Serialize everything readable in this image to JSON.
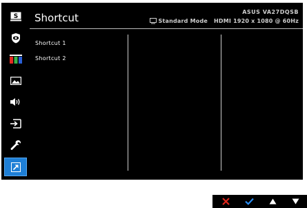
{
  "header": {
    "title": "Shortcut",
    "model": "ASUS VA27DQSB",
    "mode": "Standard Mode",
    "input_info": "HDMI 1920 x 1080 @ 60Hz"
  },
  "sidebar": {
    "items": [
      {
        "icon": "splendid-s-icon"
      },
      {
        "icon": "eye-care-icon"
      },
      {
        "icon": "color-icon"
      },
      {
        "icon": "image-icon"
      },
      {
        "icon": "sound-icon"
      },
      {
        "icon": "input-select-icon"
      },
      {
        "icon": "system-setup-icon"
      },
      {
        "icon": "shortcut-icon",
        "active": true
      }
    ]
  },
  "menu": {
    "items": [
      "Shortcut 1",
      "Shortcut 2"
    ]
  },
  "nav": {
    "buttons": [
      "close-icon",
      "check-icon",
      "up-arrow-icon",
      "down-arrow-icon"
    ]
  },
  "colors": {
    "accent": "#1e7fd6",
    "close": "#e0261b",
    "check": "#2a8ef5"
  }
}
